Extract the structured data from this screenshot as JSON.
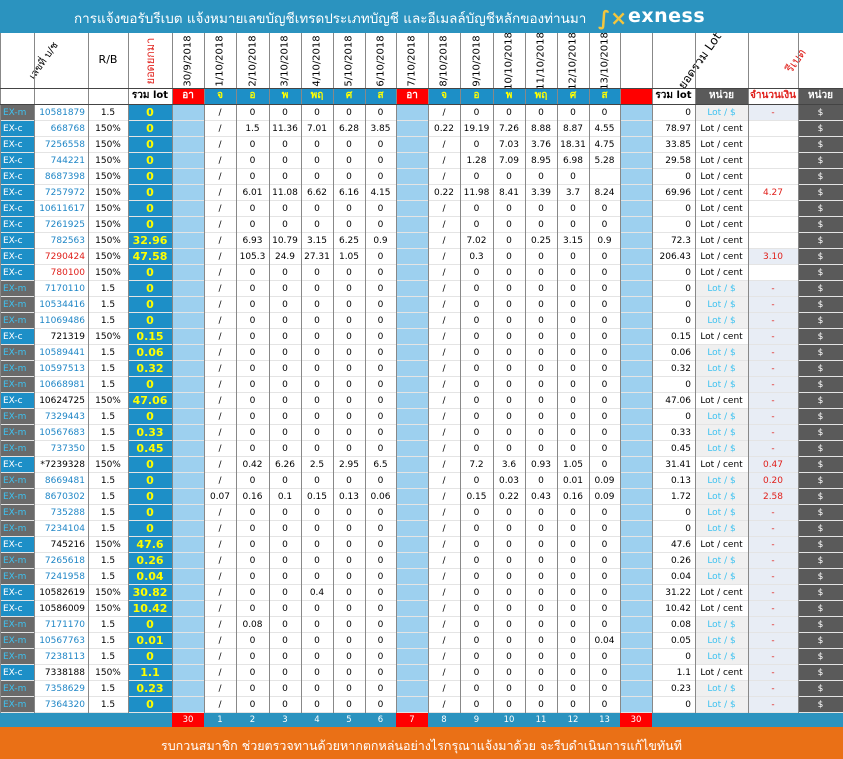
{
  "header": {
    "title": "การแจ้งขอรับรีเบต  แจ้งหมายเลขบัญชีเทรดประเภทบัญชี  และอีเมลล์บัญชีหลักของท่านมา",
    "logo_text": "exness"
  },
  "columns": {
    "account_header": "เลขที่ บ/ช",
    "rb_header": "R/B",
    "prev_header": "ยอดยกมา",
    "date_headers": [
      "30/9/2018",
      "1/10/2018",
      "2/10/2018",
      "3/10/2018",
      "4/10/2018",
      "5/10/2018",
      "6/10/2018",
      "7/10/2018",
      "8/10/2018",
      "9/10/2018",
      "10/10/2018",
      "11/10/2018",
      "12/10/2018",
      "13/10/2018",
      ""
    ],
    "total_lot_header": "ยอดรวม Lot",
    "rebate_header": "รีเบต",
    "sub_total_lot": "รวม lot",
    "sub_unit": "หน่วย",
    "sub_amount": "จำนวนเงิน",
    "sub_unit2": "หน่วย",
    "day_abbrev": [
      "อา",
      "จ",
      "อ",
      "พ",
      "พฤ",
      "ศ",
      "ส",
      "อา",
      "จ",
      "อ",
      "พ",
      "พฤ",
      "ศ",
      "ส",
      ""
    ]
  },
  "rows": [
    {
      "type": "EX-m",
      "acct": "10581879",
      "rb": "1.5",
      "prev": "0",
      "d": [
        "",
        "/",
        "0",
        "0",
        "0",
        "0",
        "0",
        "",
        "/",
        "0",
        "0",
        "0",
        "0",
        "0",
        ""
      ],
      "total": "0",
      "unit": "Lot / $",
      "amt": "-",
      "amt_color": "red",
      "cur": "$"
    },
    {
      "type": "EX-c",
      "acct": "668768",
      "rb": "150%",
      "prev": "0",
      "d": [
        "",
        "/",
        "1.5",
        "11.36",
        "7.01",
        "6.28",
        "3.85",
        "",
        "0.22",
        "19.19",
        "7.26",
        "8.88",
        "8.87",
        "4.55",
        ""
      ],
      "total": "78.97",
      "unit": "Lot / cent",
      "amt": "",
      "cur": "$"
    },
    {
      "type": "EX-c",
      "acct": "7256558",
      "rb": "150%",
      "prev": "0",
      "d": [
        "",
        "/",
        "0",
        "0",
        "0",
        "0",
        "0",
        "",
        "/",
        "0",
        "7.03",
        "3.76",
        "18.31",
        "4.75",
        ""
      ],
      "total": "33.85",
      "unit": "Lot / cent",
      "amt": "",
      "cur": "$"
    },
    {
      "type": "EX-c",
      "acct": "744221",
      "rb": "150%",
      "prev": "0",
      "d": [
        "",
        "/",
        "0",
        "0",
        "0",
        "0",
        "0",
        "",
        "/",
        "1.28",
        "7.09",
        "8.95",
        "6.98",
        "5.28",
        ""
      ],
      "total": "29.58",
      "unit": "Lot / cent",
      "amt": "",
      "cur": "$"
    },
    {
      "type": "EX-c",
      "acct": "8687398",
      "rb": "150%",
      "prev": "0",
      "d": [
        "",
        "/",
        "0",
        "0",
        "0",
        "0",
        "0",
        "",
        "/",
        "0",
        "0",
        "0",
        "0",
        "",
        ""
      ],
      "total": "0",
      "unit": "Lot / cent",
      "amt": "",
      "cur": "$"
    },
    {
      "type": "EX-c",
      "acct": "7257972",
      "rb": "150%",
      "prev": "0",
      "d": [
        "",
        "/",
        "6.01",
        "11.08",
        "6.62",
        "6.16",
        "4.15",
        "",
        "0.22",
        "11.98",
        "8.41",
        "3.39",
        "3.7",
        "8.24",
        ""
      ],
      "total": "69.96",
      "unit": "Lot / cent",
      "amt": "4.27",
      "cur": "$"
    },
    {
      "type": "EX-c",
      "acct": "10611617",
      "rb": "150%",
      "prev": "0",
      "d": [
        "",
        "/",
        "0",
        "0",
        "0",
        "0",
        "0",
        "",
        "/",
        "0",
        "0",
        "0",
        "0",
        "0",
        ""
      ],
      "total": "0",
      "unit": "Lot / cent",
      "amt": "",
      "cur": "$"
    },
    {
      "type": "EX-c",
      "acct": "7261925",
      "rb": "150%",
      "prev": "0",
      "d": [
        "",
        "/",
        "0",
        "0",
        "0",
        "0",
        "0",
        "",
        "/",
        "0",
        "0",
        "0",
        "0",
        "0",
        ""
      ],
      "total": "0",
      "unit": "Lot / cent",
      "amt": "",
      "cur": "$"
    },
    {
      "type": "EX-c",
      "acct": "782563",
      "rb": "150%",
      "prev": "32.96",
      "d": [
        "",
        "/",
        "6.93",
        "10.79",
        "3.15",
        "6.25",
        "0.9",
        "",
        "/",
        "7.02",
        "0",
        "0.25",
        "3.15",
        "0.9",
        ""
      ],
      "total": "72.3",
      "unit": "Lot / cent",
      "amt": "",
      "cur": "$"
    },
    {
      "type": "EX-c",
      "acct": "7290424",
      "rb": "150%",
      "prev": "47.58",
      "d": [
        "",
        "/",
        "105.3",
        "24.9",
        "27.31",
        "1.05",
        "0",
        "",
        "/",
        "0.3",
        "0",
        "0",
        "0",
        "0",
        ""
      ],
      "total": "206.43",
      "unit": "Lot / cent",
      "amt": "3.10",
      "cur": "$"
    },
    {
      "type": "EX-c",
      "acct": "780100",
      "rb": "150%",
      "prev": "0",
      "d": [
        "",
        "/",
        "0",
        "0",
        "0",
        "0",
        "0",
        "",
        "/",
        "0",
        "0",
        "0",
        "0",
        "0",
        ""
      ],
      "total": "0",
      "unit": "Lot / cent",
      "amt": "",
      "cur": "$"
    },
    {
      "type": "EX-m",
      "acct": "7170110",
      "rb": "1.5",
      "prev": "0",
      "d": [
        "",
        "/",
        "0",
        "0",
        "0",
        "0",
        "0",
        "",
        "/",
        "0",
        "0",
        "0",
        "0",
        "0",
        ""
      ],
      "total": "0",
      "unit": "Lot / $",
      "amt": "-",
      "cur": "$"
    },
    {
      "type": "EX-m",
      "acct": "10534416",
      "rb": "1.5",
      "prev": "0",
      "d": [
        "",
        "/",
        "0",
        "0",
        "0",
        "0",
        "0",
        "",
        "/",
        "0",
        "0",
        "0",
        "0",
        "0",
        ""
      ],
      "total": "0",
      "unit": "Lot / $",
      "amt": "-",
      "cur": "$"
    },
    {
      "type": "EX-m",
      "acct": "11069486",
      "rb": "1.5",
      "prev": "0",
      "d": [
        "",
        "/",
        "0",
        "0",
        "0",
        "0",
        "0",
        "",
        "/",
        "0",
        "0",
        "0",
        "0",
        "0",
        ""
      ],
      "total": "0",
      "unit": "Lot / $",
      "amt": "-",
      "cur": "$"
    },
    {
      "type": "EX-c",
      "acct": "721319",
      "rb": "150%",
      "prev": "0.15",
      "d": [
        "",
        "/",
        "0",
        "0",
        "0",
        "0",
        "0",
        "",
        "/",
        "0",
        "0",
        "0",
        "0",
        "0",
        ""
      ],
      "total": "0.15",
      "unit": "Lot / cent",
      "amt": "-",
      "cur": "$"
    },
    {
      "type": "EX-m",
      "acct": "10589441",
      "rb": "1.5",
      "prev": "0.06",
      "d": [
        "",
        "/",
        "0",
        "0",
        "0",
        "0",
        "0",
        "",
        "/",
        "0",
        "0",
        "0",
        "0",
        "0",
        ""
      ],
      "total": "0.06",
      "unit": "Lot / $",
      "amt": "-",
      "cur": "$"
    },
    {
      "type": "EX-m",
      "acct": "10597513",
      "rb": "1.5",
      "prev": "0.32",
      "d": [
        "",
        "/",
        "0",
        "0",
        "0",
        "0",
        "0",
        "",
        "/",
        "0",
        "0",
        "0",
        "0",
        "0",
        ""
      ],
      "total": "0.32",
      "unit": "Lot / $",
      "amt": "-",
      "cur": "$"
    },
    {
      "type": "EX-m",
      "acct": "10668981",
      "rb": "1.5",
      "prev": "0",
      "d": [
        "",
        "/",
        "0",
        "0",
        "0",
        "0",
        "0",
        "",
        "/",
        "0",
        "0",
        "0",
        "0",
        "0",
        ""
      ],
      "total": "0",
      "unit": "Lot / $",
      "amt": "-",
      "cur": "$"
    },
    {
      "type": "EX-c",
      "acct": "10624725",
      "rb": "150%",
      "prev": "47.06",
      "d": [
        "",
        "/",
        "0",
        "0",
        "0",
        "0",
        "0",
        "",
        "/",
        "0",
        "0",
        "0",
        "0",
        "0",
        ""
      ],
      "total": "47.06",
      "unit": "Lot / cent",
      "amt": "-",
      "cur": "$"
    },
    {
      "type": "EX-m",
      "acct": "7329443",
      "rb": "1.5",
      "prev": "0",
      "d": [
        "",
        "/",
        "0",
        "0",
        "0",
        "0",
        "0",
        "",
        "/",
        "0",
        "0",
        "0",
        "0",
        "0",
        ""
      ],
      "total": "0",
      "unit": "Lot / $",
      "amt": "-",
      "cur": "$"
    },
    {
      "type": "EX-m",
      "acct": "10567683",
      "rb": "1.5",
      "prev": "0.33",
      "d": [
        "",
        "/",
        "0",
        "0",
        "0",
        "0",
        "0",
        "",
        "/",
        "0",
        "0",
        "0",
        "0",
        "0",
        ""
      ],
      "total": "0.33",
      "unit": "Lot / $",
      "amt": "-",
      "cur": "$"
    },
    {
      "type": "EX-m",
      "acct": "737350",
      "rb": "1.5",
      "prev": "0.45",
      "d": [
        "",
        "/",
        "0",
        "0",
        "0",
        "0",
        "0",
        "",
        "/",
        "0",
        "0",
        "0",
        "0",
        "0",
        ""
      ],
      "total": "0.45",
      "unit": "Lot / $",
      "amt": "-",
      "cur": "$"
    },
    {
      "type": "EX-c",
      "acct": "*7239328",
      "rb": "150%",
      "prev": "0",
      "d": [
        "",
        "/",
        "0.42",
        "6.26",
        "2.5",
        "2.95",
        "6.5",
        "",
        "/",
        "7.2",
        "3.6",
        "0.93",
        "1.05",
        "0",
        ""
      ],
      "total": "31.41",
      "unit": "Lot / cent",
      "amt": "0.47",
      "cur": "$"
    },
    {
      "type": "EX-m",
      "acct": "8669481",
      "rb": "1.5",
      "prev": "0",
      "d": [
        "",
        "/",
        "0",
        "0",
        "0",
        "0",
        "0",
        "",
        "/",
        "0",
        "0.03",
        "0",
        "0.01",
        "0.09",
        ""
      ],
      "total": "0.13",
      "unit": "Lot / $",
      "amt": "0.20",
      "cur": "$"
    },
    {
      "type": "EX-m",
      "acct": "8670302",
      "rb": "1.5",
      "prev": "0",
      "d": [
        "",
        "0.07",
        "0.16",
        "0.1",
        "0.15",
        "0.13",
        "0.06",
        "",
        "/",
        "0.15",
        "0.22",
        "0.43",
        "0.16",
        "0.09",
        ""
      ],
      "total": "1.72",
      "unit": "Lot / $",
      "amt": "2.58",
      "cur": "$"
    },
    {
      "type": "EX-m",
      "acct": "735288",
      "rb": "1.5",
      "prev": "0",
      "d": [
        "",
        "/",
        "0",
        "0",
        "0",
        "0",
        "0",
        "",
        "/",
        "0",
        "0",
        "0",
        "0",
        "0",
        ""
      ],
      "total": "0",
      "unit": "Lot / $",
      "amt": "-",
      "cur": "$"
    },
    {
      "type": "EX-m",
      "acct": "7234104",
      "rb": "1.5",
      "prev": "0",
      "d": [
        "",
        "/",
        "0",
        "0",
        "0",
        "0",
        "0",
        "",
        "/",
        "0",
        "0",
        "0",
        "0",
        "0",
        ""
      ],
      "total": "0",
      "unit": "Lot / $",
      "amt": "-",
      "cur": "$"
    },
    {
      "type": "EX-c",
      "acct": "745216",
      "rb": "150%",
      "prev": "47.6",
      "d": [
        "",
        "/",
        "0",
        "0",
        "0",
        "0",
        "0",
        "",
        "/",
        "0",
        "0",
        "0",
        "0",
        "0",
        ""
      ],
      "total": "47.6",
      "unit": "Lot / cent",
      "amt": "-",
      "cur": "$"
    },
    {
      "type": "EX-m",
      "acct": "7265618",
      "rb": "1.5",
      "prev": "0.26",
      "d": [
        "",
        "/",
        "0",
        "0",
        "0",
        "0",
        "0",
        "",
        "/",
        "0",
        "0",
        "0",
        "0",
        "0",
        ""
      ],
      "total": "0.26",
      "unit": "Lot / $",
      "amt": "-",
      "cur": "$"
    },
    {
      "type": "EX-m",
      "acct": "7241958",
      "rb": "1.5",
      "prev": "0.04",
      "d": [
        "",
        "/",
        "0",
        "0",
        "0",
        "0",
        "0",
        "",
        "/",
        "0",
        "0",
        "0",
        "0",
        "0",
        ""
      ],
      "total": "0.04",
      "unit": "Lot / $",
      "amt": "-",
      "cur": "$"
    },
    {
      "type": "EX-c",
      "acct": "10582619",
      "rb": "150%",
      "prev": "30.82",
      "d": [
        "",
        "/",
        "0",
        "0",
        "0.4",
        "0",
        "0",
        "",
        "/",
        "0",
        "0",
        "0",
        "0",
        "0",
        ""
      ],
      "total": "31.22",
      "unit": "Lot / cent",
      "amt": "-",
      "cur": "$"
    },
    {
      "type": "EX-c",
      "acct": "10586009",
      "rb": "150%",
      "prev": "10.42",
      "d": [
        "",
        "/",
        "0",
        "0",
        "0",
        "0",
        "0",
        "",
        "/",
        "0",
        "0",
        "0",
        "0",
        "0",
        ""
      ],
      "total": "10.42",
      "unit": "Lot / cent",
      "amt": "-",
      "cur": "$"
    },
    {
      "type": "EX-m",
      "acct": "7171170",
      "rb": "1.5",
      "prev": "0",
      "d": [
        "",
        "/",
        "0.08",
        "0",
        "0",
        "0",
        "0",
        "",
        "/",
        "0",
        "0",
        "0",
        "0",
        "0",
        ""
      ],
      "total": "0.08",
      "unit": "Lot / $",
      "amt": "-",
      "cur": "$"
    },
    {
      "type": "EX-m",
      "acct": "10567763",
      "rb": "1.5",
      "prev": "0.01",
      "d": [
        "",
        "/",
        "0",
        "0",
        "0",
        "0",
        "0",
        "",
        "/",
        "0",
        "0",
        "0",
        "0",
        "0.04",
        ""
      ],
      "total": "0.05",
      "unit": "Lot / $",
      "amt": "-",
      "cur": "$"
    },
    {
      "type": "EX-m",
      "acct": "7238113",
      "rb": "1.5",
      "prev": "0",
      "d": [
        "",
        "/",
        "0",
        "0",
        "0",
        "0",
        "0",
        "",
        "/",
        "0",
        "0",
        "0",
        "0",
        "0",
        ""
      ],
      "total": "0",
      "unit": "Lot / $",
      "amt": "-",
      "cur": "$"
    },
    {
      "type": "EX-c",
      "acct": "7338188",
      "rb": "150%",
      "prev": "1.1",
      "d": [
        "",
        "/",
        "0",
        "0",
        "0",
        "0",
        "0",
        "",
        "/",
        "0",
        "0",
        "0",
        "0",
        "0",
        ""
      ],
      "total": "1.1",
      "unit": "Lot / cent",
      "amt": "-",
      "cur": "$"
    },
    {
      "type": "EX-m",
      "acct": "7358629",
      "rb": "1.5",
      "prev": "0.23",
      "d": [
        "",
        "/",
        "0",
        "0",
        "0",
        "0",
        "0",
        "",
        "/",
        "0",
        "0",
        "0",
        "0",
        "0",
        ""
      ],
      "total": "0.23",
      "unit": "Lot / $",
      "amt": "-",
      "cur": "$"
    },
    {
      "type": "EX-m",
      "acct": "7364320",
      "rb": "1.5",
      "prev": "0",
      "d": [
        "",
        "/",
        "0",
        "0",
        "0",
        "0",
        "0",
        "",
        "/",
        "0",
        "0",
        "0",
        "0",
        "0",
        ""
      ],
      "total": "0",
      "unit": "Lot / $",
      "amt": "-",
      "cur": "$"
    }
  ],
  "footer_days": [
    "30",
    "1",
    "2",
    "3",
    "4",
    "5",
    "6",
    "7",
    "8",
    "9",
    "10",
    "11",
    "12",
    "13",
    "30"
  ],
  "footer": {
    "message": "รบกวนสมาชิก ช่วยตรวจทานด้วยหากตกหล่นอย่างไรกรุณาแจ้งมาด้วย  จะรีบดำเนินการแก้ไขทันที"
  },
  "colors": {
    "title_bar": "#2b93bf",
    "footer": "#ea7016",
    "ex_m": "#2f9fd1",
    "ex_c": "#2f9fd1",
    "prev_bg": "#1d8fc7",
    "prev_text": "#ffff00",
    "sunday_bg": "#9dd0ef",
    "total_bg": "#5a5a5a",
    "rebate_red": "#e0201b",
    "acct_blue_text": "#1f86c6"
  }
}
